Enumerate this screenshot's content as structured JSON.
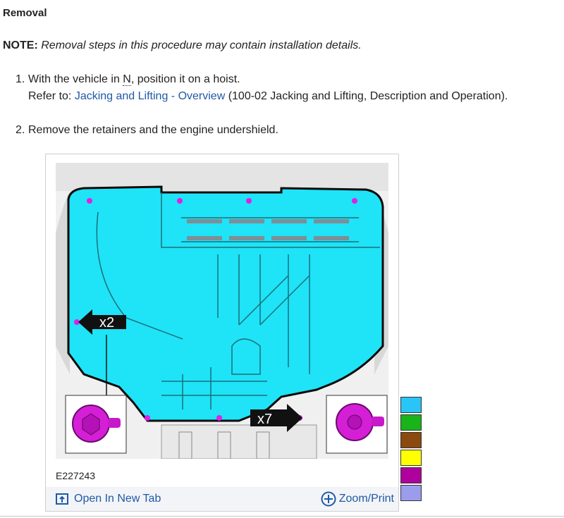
{
  "section": {
    "heading": "Removal"
  },
  "note": {
    "label": "NOTE:",
    "text": "Removal steps in this procedure may contain installation details."
  },
  "steps": [
    {
      "num": "1.",
      "pre": "With the vehicle in ",
      "abbr": "N",
      "post": ", position it on a hoist.",
      "refer_label": "Refer to: ",
      "refer_link": "Jacking and Lifting - Overview",
      "refer_suffix": " (100-02 Jacking and Lifting, Description and Operation)."
    },
    {
      "num": "2.",
      "text": "Remove the retainers and the engine undershield."
    }
  ],
  "figure": {
    "callout_left": "x2",
    "callout_right": "x7",
    "image_id": "E227243",
    "open_tab_label": "Open In New Tab",
    "zoom_label": "Zoom/Print"
  },
  "color_key": [
    "#29c5f6",
    "#19b419",
    "#8b4a0e",
    "#ffff00",
    "#b0009e",
    "#9c9ced"
  ],
  "colors": {
    "link": "#1f5aa6",
    "shield": "#1fe3f7",
    "fastener": "#e21ee6"
  }
}
